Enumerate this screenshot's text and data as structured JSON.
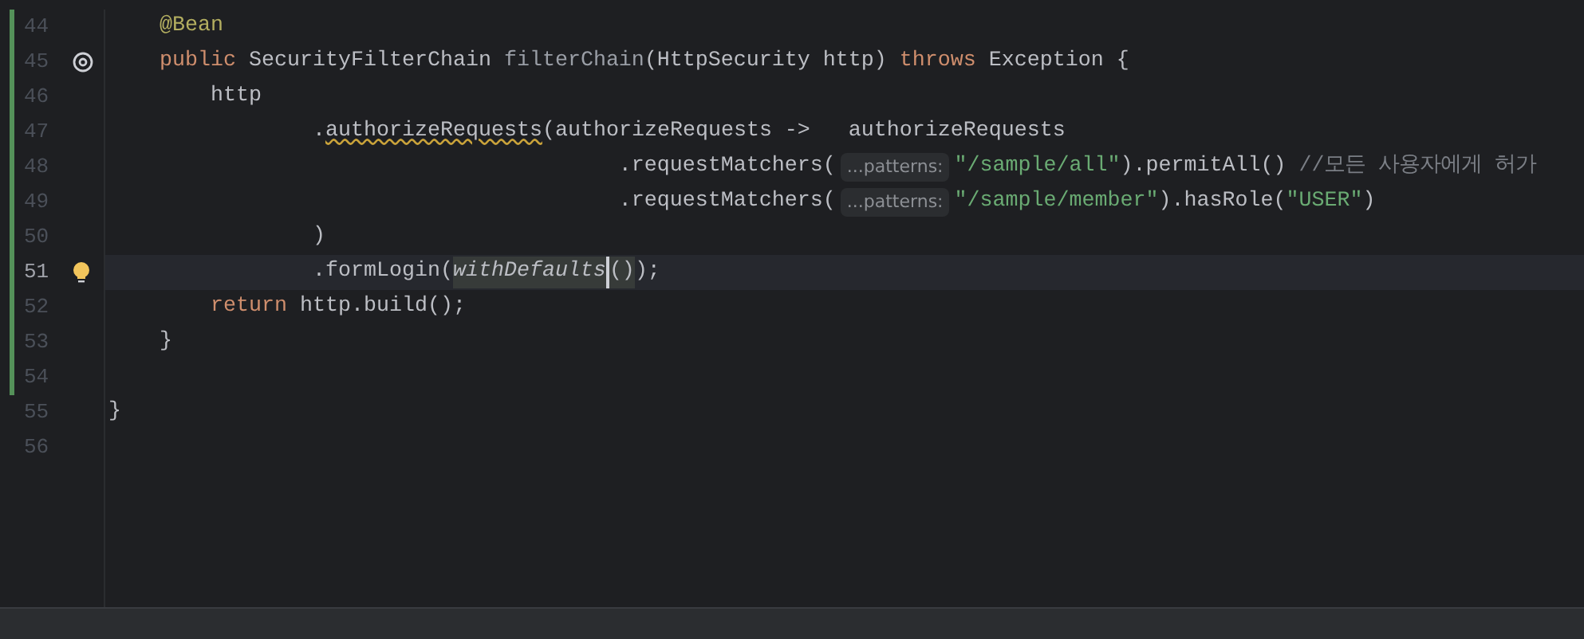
{
  "lines": [
    {
      "number": "44",
      "changed": true,
      "current": false,
      "tokens": [
        {
          "text": "    @Bean",
          "kind": "annotation"
        }
      ]
    },
    {
      "number": "45",
      "changed": true,
      "current": false,
      "gutter_icon": {
        "kind": "at"
      },
      "tokens": [
        {
          "text": "    public ",
          "kind": "keyword"
        },
        {
          "text": "SecurityFilterChain ",
          "kind": "plain"
        },
        {
          "text": "filterChain",
          "kind": "unused"
        },
        {
          "text": "(HttpSecurity http) ",
          "kind": "plain"
        },
        {
          "text": "throws ",
          "kind": "keyword"
        },
        {
          "text": "Exception {",
          "kind": "plain"
        }
      ]
    },
    {
      "number": "46",
      "changed": true,
      "current": false,
      "tokens": [
        {
          "text": "        http",
          "kind": "plain"
        }
      ]
    },
    {
      "number": "47",
      "changed": true,
      "current": false,
      "tokens": [
        {
          "text": "                .",
          "kind": "plain"
        },
        {
          "text": "authorizeRequests",
          "kind": "plain",
          "warning": true
        },
        {
          "text": "(authorizeRequests ->   authorizeRequests",
          "kind": "plain"
        }
      ]
    },
    {
      "number": "48",
      "changed": true,
      "current": false,
      "tokens": [
        {
          "text": "                                        .requestMatchers(",
          "kind": "plain"
        },
        {
          "text": "...patterns:",
          "kind": "hint"
        },
        {
          "text": "\"/sample/all\"",
          "kind": "string"
        },
        {
          "text": ").permitAll() ",
          "kind": "plain"
        },
        {
          "text": "//모든 사용자에게 허가",
          "kind": "comment"
        }
      ]
    },
    {
      "number": "49",
      "changed": true,
      "current": false,
      "tokens": [
        {
          "text": "                                        .requestMatchers(",
          "kind": "plain"
        },
        {
          "text": "...patterns:",
          "kind": "hint"
        },
        {
          "text": "\"/sample/member\"",
          "kind": "string"
        },
        {
          "text": ").hasRole(",
          "kind": "plain"
        },
        {
          "text": "\"USER\"",
          "kind": "string"
        },
        {
          "text": ")",
          "kind": "plain"
        }
      ]
    },
    {
      "number": "50",
      "changed": true,
      "current": false,
      "tokens": [
        {
          "text": "                )",
          "kind": "plain"
        }
      ]
    },
    {
      "number": "51",
      "changed": true,
      "current": true,
      "gutter_icon": {
        "kind": "bulb"
      },
      "tokens": [
        {
          "text": "                .formLogin(",
          "kind": "plain"
        },
        {
          "text": "withDefaults",
          "kind": "static",
          "highlighted": true,
          "caret_after": true
        },
        {
          "text": "()",
          "kind": "plain",
          "highlighted": true
        },
        {
          "text": ");",
          "kind": "plain"
        }
      ]
    },
    {
      "number": "52",
      "changed": true,
      "current": false,
      "tokens": [
        {
          "text": "        return ",
          "kind": "keyword"
        },
        {
          "text": "http.build();",
          "kind": "plain"
        }
      ]
    },
    {
      "number": "53",
      "changed": true,
      "current": false,
      "tokens": [
        {
          "text": "    }",
          "kind": "plain"
        }
      ]
    },
    {
      "number": "54",
      "changed": true,
      "current": false
    },
    {
      "number": "55",
      "changed": false,
      "current": false,
      "tokens": [
        {
          "text": "}",
          "kind": "plain"
        }
      ]
    },
    {
      "number": "56",
      "changed": false,
      "current": false
    }
  ]
}
